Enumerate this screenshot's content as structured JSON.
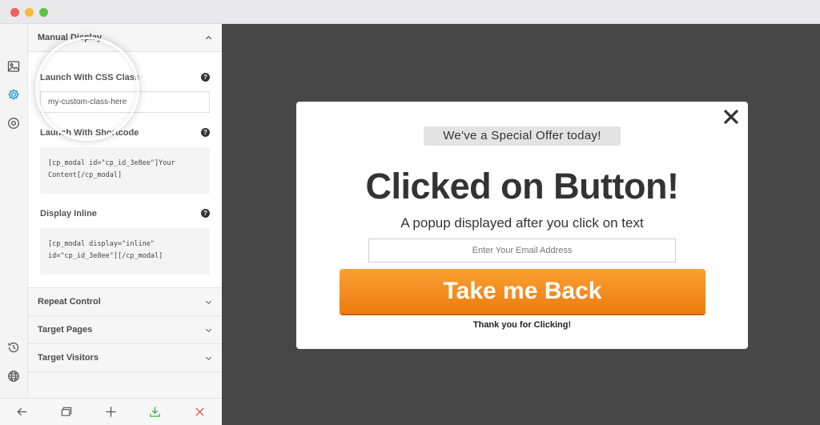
{
  "window": {
    "controls": [
      "close",
      "minimize",
      "maximize"
    ]
  },
  "rail": {
    "icons": [
      "image-icon",
      "gear-icon",
      "target-icon",
      "history-icon",
      "globe-icon"
    ],
    "active_color": "#1e9ad6"
  },
  "panel": {
    "manual_display": {
      "title": "Manual Display",
      "launch_css_label": "Launch With CSS Class",
      "css_class_value": "my-custom-class-here",
      "shortcode_label": "Launch With Shortcode",
      "shortcode_code": "[cp_modal id=\"cp_id_3e8ee\"]Your Content[/cp_modal]",
      "inline_label": "Display Inline",
      "inline_code": "[cp_modal display=\"inline\" id=\"cp_id_3e8ee\"][/cp_modal]",
      "help_glyph": "?"
    },
    "sections": [
      {
        "label": "Repeat Control"
      },
      {
        "label": "Target Pages"
      },
      {
        "label": "Target Visitors"
      }
    ]
  },
  "toolbar": {
    "buttons": [
      "back-icon",
      "preview-icon",
      "add-icon",
      "save-icon",
      "close-icon"
    ],
    "save_color": "#3bb54a",
    "close_color": "#e05a5a"
  },
  "popup": {
    "badge": "We've a Special Offer today!",
    "headline": "Clicked on Button!",
    "subheading": "A popup displayed after you click on text",
    "email_placeholder": "Enter Your Email Address",
    "cta": "Take me Back",
    "thanks": "Thank you for Clicking!",
    "cta_color": "#f18a1e",
    "close_glyph": "✕"
  }
}
